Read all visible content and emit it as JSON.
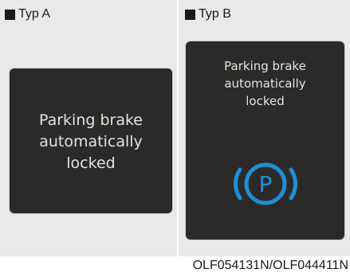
{
  "type_a": {
    "label": "Typ A",
    "message_lines": [
      "Parking brake",
      "automatically",
      "locked"
    ]
  },
  "type_b": {
    "label": "Typ B",
    "message_lines": [
      "Parking brake",
      "automatically",
      "locked"
    ],
    "icon": "parking-brake-icon",
    "icon_letter": "P",
    "icon_color": "#1c8fd6"
  },
  "image_code": "OLF054131N/OLF044411N",
  "colors": {
    "panel_bg": "#e9e9e7",
    "screen_bg": "#2c2a28",
    "screen_text": "#e4e4e2"
  }
}
